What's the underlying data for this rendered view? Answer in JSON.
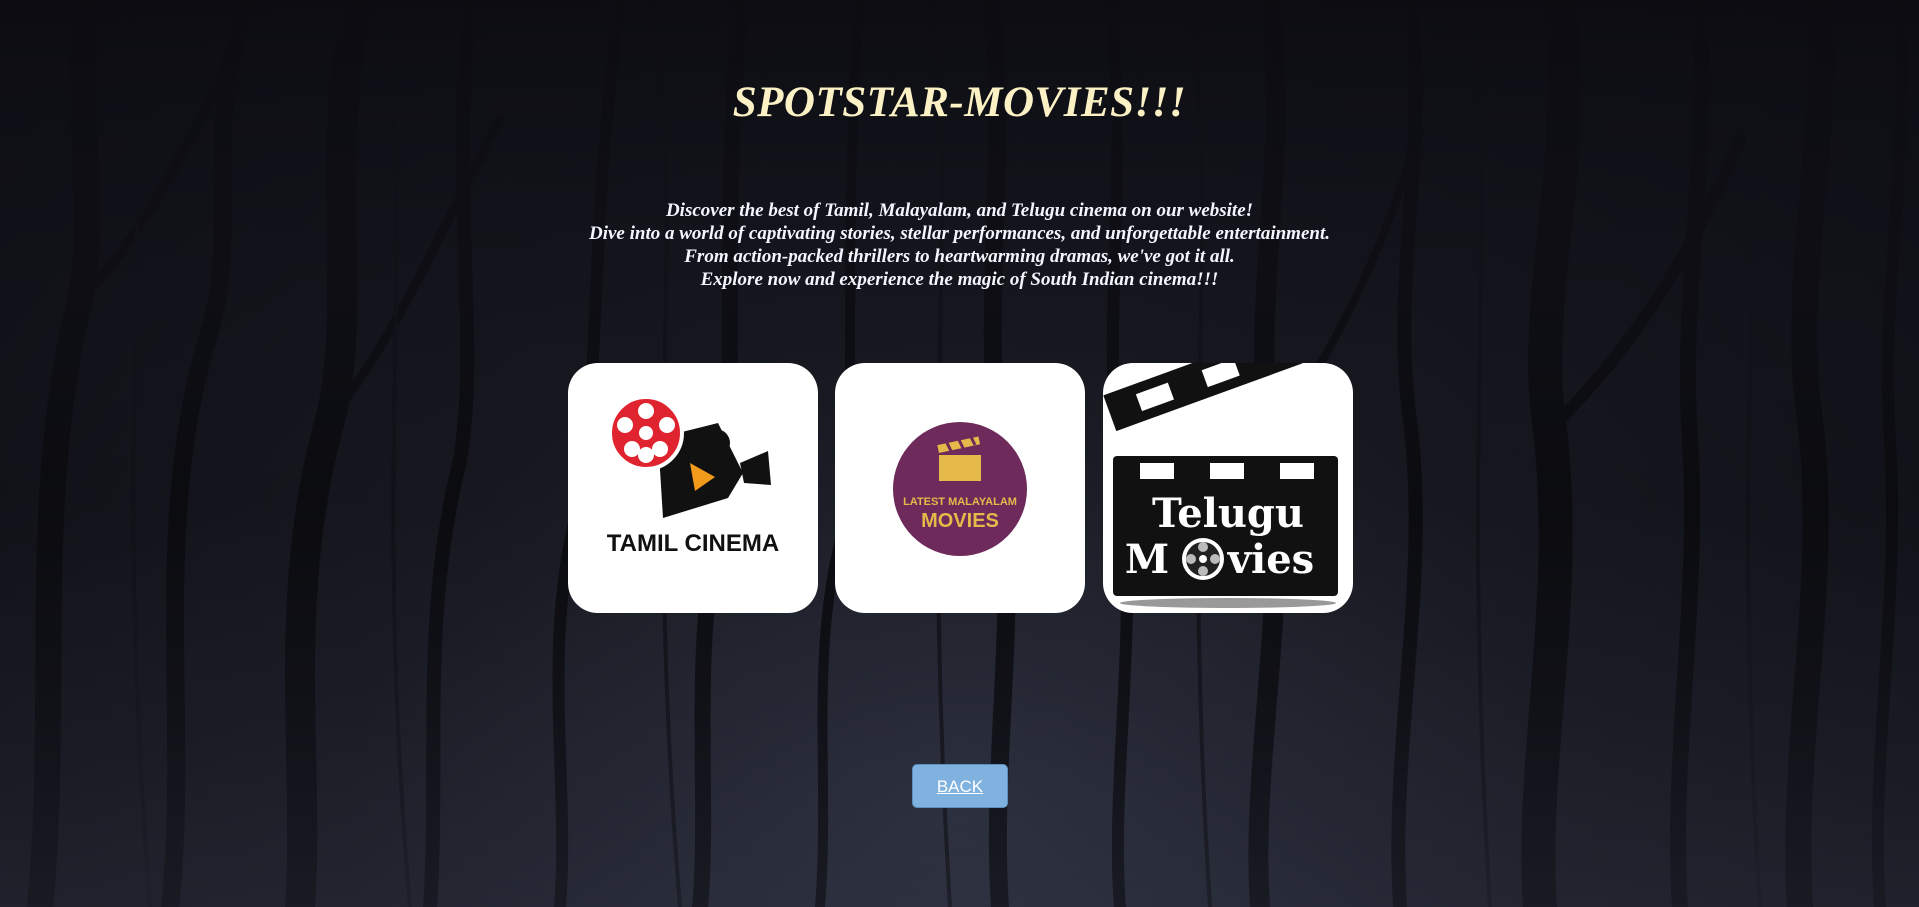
{
  "page": {
    "title": "SPOTSTAR-MOVIES!!!",
    "intro_lines": [
      "Discover the best of Tamil, Malayalam, and Telugu cinema on our website!",
      "Dive into a world of captivating stories, stellar performances, and unforgettable entertainment.",
      "From action-packed thrillers to heartwarming dramas, we've got it all.",
      "Explore now and experience the magic of South Indian cinema!!!"
    ]
  },
  "cards": [
    {
      "logo_text": "TAMIL CINEMA",
      "icon": "movie-camera-reel-icon"
    },
    {
      "logo_line1": "LATEST MALAYALAM",
      "logo_line2": "MOVIES",
      "icon": "clapperboard-icon"
    },
    {
      "logo_line1": "Telugu",
      "logo_line2_start": "M",
      "logo_line2_end": "vies",
      "icon": "film-reel-icon"
    }
  ],
  "back_button": {
    "label": "BACK"
  },
  "colors": {
    "title": "#fbf1c5",
    "intro_text": "#f4f6ff",
    "back_button_bg": "#7fb2de",
    "card_bg": "#ffffff",
    "tamil_reel_red": "#e0242f",
    "malayalam_circle": "#6e2a5a",
    "malayalam_gold": "#e5b94a"
  }
}
